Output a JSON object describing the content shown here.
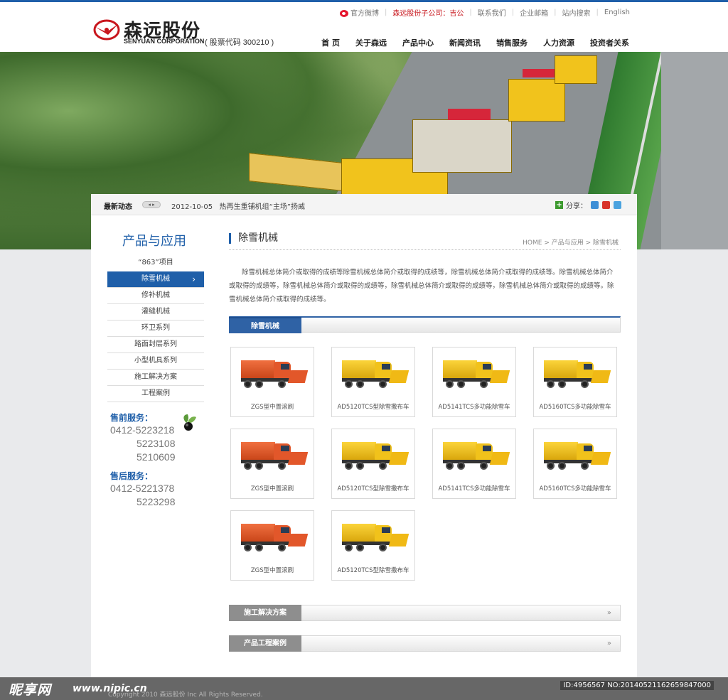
{
  "header": {
    "logo_cn": "森远股份",
    "logo_en": "SENYUAN CORPORATION",
    "stock_code": "( 股票代码 300210 )",
    "toplinks": [
      "官方微博",
      "森远股份子公司：吉公",
      "联系我们",
      "企业邮箱",
      "站内搜索",
      "English"
    ],
    "nav": [
      "首 页",
      "关于森远",
      "产品中心",
      "新闻资讯",
      "销售服务",
      "人力资源",
      "投资者关系"
    ]
  },
  "newsbar": {
    "label": "最新动态",
    "date": "2012-10-05",
    "headline": "热再生重铺机组“主场”扬威",
    "share_label": "分享："
  },
  "sidebar": {
    "title": "产品与应用",
    "items": [
      "“863”项目",
      "除雪机械",
      "修补机械",
      "灌缝机械",
      "环卫系列",
      "路面封层系列",
      "小型机具系列",
      "施工解决方案",
      "工程案例"
    ],
    "presale_label": "售前服务：",
    "presale_numbers": [
      "0412-5223218",
      "5223108",
      "5210609"
    ],
    "aftersale_label": "售后服务：",
    "aftersale_numbers": [
      "0412-5221378",
      "5223298"
    ]
  },
  "content": {
    "title": "除雪机械",
    "breadcrumb": "HOME > 产品与应用 > 除雪机械",
    "intro": "除雪机械总体简介或取得的成绩等除雪机械总体简介或取得的成绩等，除雪机械总体简介或取得的成绩等。除雪机械总体简介或取得的成绩等，除雪机械总体简介或取得的成绩等，除雪机械总体简介或取得的成绩等，除雪机械总体简介或取得的成绩等。除雪机械总体简介或取得的成绩等。",
    "section1": "除雪机械",
    "section2": "施工解决方案",
    "section3": "产品工程案例",
    "more": "»"
  },
  "products": [
    {
      "name": "ZGS型中置滚刷",
      "color": "orange"
    },
    {
      "name": "AD5120TCS型除雪撒布车",
      "color": "yellow"
    },
    {
      "name": "AD5141TCS多功能除雪车",
      "color": "yellow"
    },
    {
      "name": "AD5160TCS多功能除雪车",
      "color": "yellow"
    },
    {
      "name": "ZGS型中置滚刷",
      "color": "orange"
    },
    {
      "name": "AD5120TCS型除雪撒布车",
      "color": "yellow"
    },
    {
      "name": "AD5141TCS多功能除雪车",
      "color": "yellow"
    },
    {
      "name": "AD5160TCS多功能除雪车",
      "color": "yellow"
    },
    {
      "name": "ZGS型中置滚刷",
      "color": "orange"
    },
    {
      "name": "AD5120TCS型除雪撒布车",
      "color": "yellow"
    }
  ],
  "footer": {
    "copyright": "Copyright 2010 森远股份 Inc All Rights Reserved."
  },
  "watermark": {
    "brand": "昵享网",
    "url": "www.nipic.cn",
    "id": "ID:4956567 NO:20140521162659847000"
  },
  "colors": {
    "accent": "#1f5fa9",
    "brand_red": "#c8161d"
  }
}
